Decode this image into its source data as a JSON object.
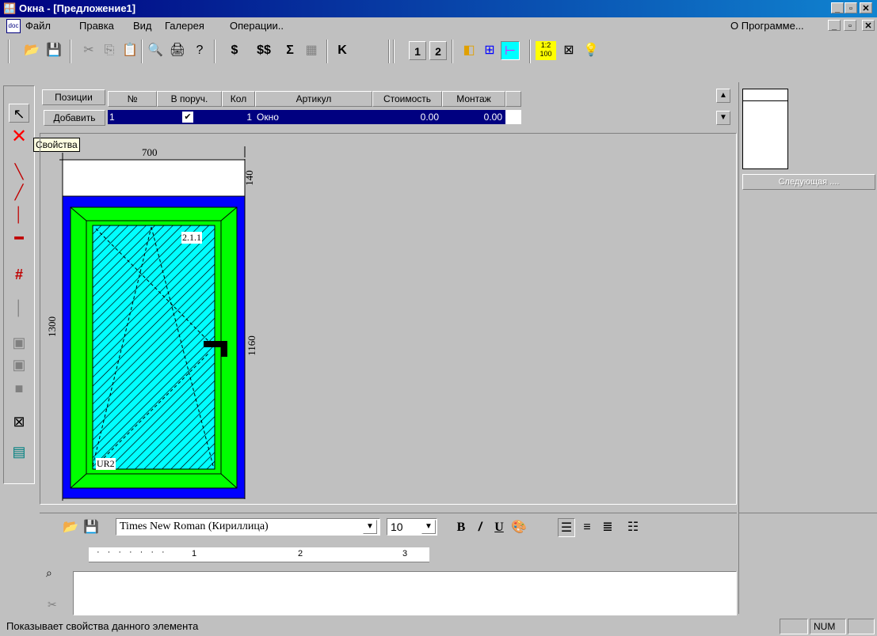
{
  "title": "Окна - [Предложение1]",
  "menu": [
    "Файл",
    "Правка",
    "Вид",
    "Галерея",
    "Операции.."
  ],
  "menu_right": "О Программе...",
  "toolbar": {
    "btn_1": "1",
    "btn_2": "2",
    "ratio": "1:2\n100",
    "dollar": "$",
    "dollars": "$$",
    "sigma": "Σ",
    "k": "K"
  },
  "grid": {
    "headers": [
      "Позиции",
      "№",
      "В поруч.",
      "Кол",
      "Артикул",
      "Стоимость",
      "Монтаж"
    ],
    "add_button": "Добавить",
    "row": {
      "num": "1",
      "checked": "✔",
      "qty": "1",
      "article": "Окно",
      "cost": "0.00",
      "mount": "0.00"
    }
  },
  "tooltip": "Свойства",
  "drawing": {
    "width": "700",
    "top_height": "140",
    "total_height": "1300",
    "sash_height": "1160",
    "sash_label": "2.1.1",
    "glass_label": "UR2"
  },
  "right_panel": {
    "next_button": "Следующая ...."
  },
  "editor": {
    "font": "Times New Roman (Кириллица)",
    "size": "10",
    "ruler": [
      "1",
      "2",
      "3"
    ]
  },
  "status": {
    "text": "Показывает свойства данного элемента",
    "num": "NUM"
  },
  "colors": {
    "frame": "#0000ff",
    "sash": "#00ff00",
    "glass": "#00ffff",
    "titlebar": "#000080"
  }
}
